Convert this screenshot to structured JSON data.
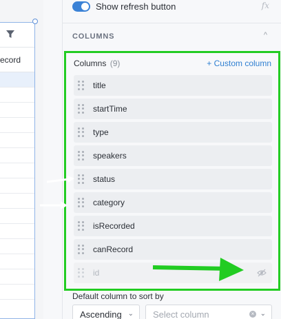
{
  "table_preview": {
    "header_fragment": "ecord"
  },
  "panel": {
    "toggle_label": "Show refresh button",
    "fx_label": "fx",
    "section_title": "COLUMNS",
    "columns_label": "Columns",
    "columns_count": "(9)",
    "custom_column_label": "+ Custom column",
    "columns": [
      {
        "label": "title",
        "hidden": false
      },
      {
        "label": "startTime",
        "hidden": false
      },
      {
        "label": "type",
        "hidden": false
      },
      {
        "label": "speakers",
        "hidden": false
      },
      {
        "label": "status",
        "hidden": false
      },
      {
        "label": "category",
        "hidden": false
      },
      {
        "label": "isRecorded",
        "hidden": false
      },
      {
        "label": "canRecord",
        "hidden": false
      },
      {
        "label": "id",
        "hidden": true
      }
    ],
    "sort_label": "Default column to sort by",
    "sort_direction": "Ascending",
    "sort_column_placeholder": "Select column"
  },
  "colors": {
    "highlight_box": "#22cc22",
    "toggle_on": "#3b82d6",
    "link": "#2f7fd1"
  }
}
